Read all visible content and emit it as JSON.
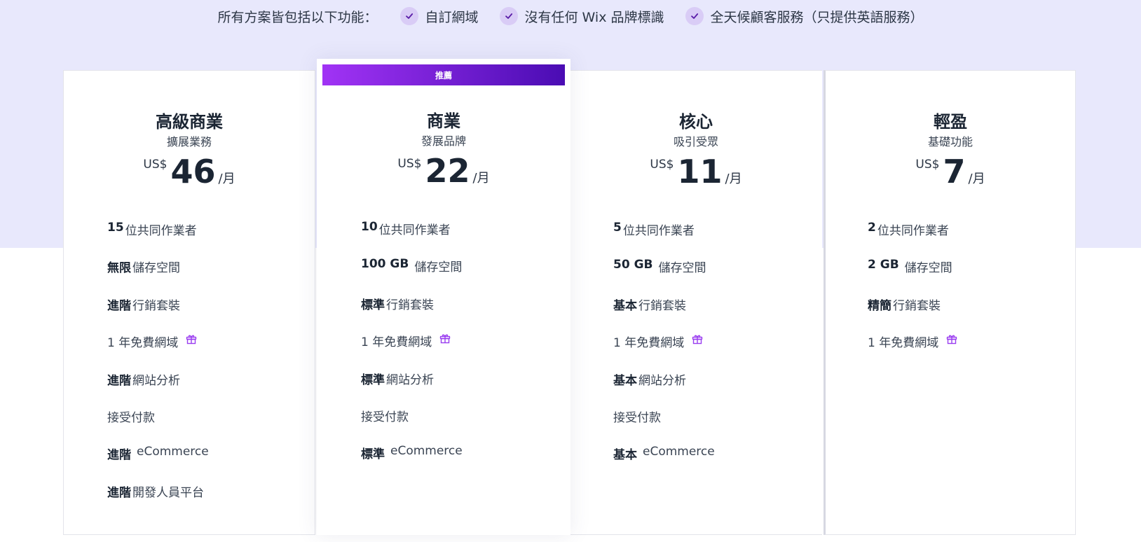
{
  "includes_bar": {
    "title": "所有方案皆包括以下功能：",
    "items": [
      {
        "label": "自訂網域"
      },
      {
        "label": "沒有任何 Wix 品牌標識"
      },
      {
        "label": "全天候顧客服務（只提供英語服務）"
      }
    ]
  },
  "colors": {
    "accent": "#7d1ce8",
    "band": "#e8e8fc",
    "badge_gradient_start": "#a133f5",
    "badge_gradient_end": "#4a0cb3",
    "icon_check": "check-icon",
    "icon_gift": "gift-icon"
  },
  "plans": [
    {
      "name": "高級商業",
      "tagline": "擴展業務",
      "currency": "US$",
      "amount": "46",
      "period": "/月",
      "features": [
        {
          "bold": "15",
          "text": "位共同作業者"
        },
        {
          "bold": "無限",
          "text": "儲存空間"
        },
        {
          "bold": "進階",
          "text": "行銷套裝"
        },
        {
          "bold": "",
          "text": "1 年免費網域",
          "gift": true
        },
        {
          "bold": "進階",
          "text": "網站分析"
        },
        {
          "bold": "",
          "text": "接受付款"
        },
        {
          "bold": "進階",
          "text": "eCommerce"
        },
        {
          "bold": "進階",
          "text": "開發人員平台"
        }
      ]
    },
    {
      "name": "商業",
      "tagline": "發展品牌",
      "badge": "推薦",
      "currency": "US$",
      "amount": "22",
      "period": "/月",
      "features": [
        {
          "bold": "10",
          "text": "位共同作業者"
        },
        {
          "bold": "100 GB",
          "text": "儲存空間"
        },
        {
          "bold": "標準",
          "text": "行銷套裝"
        },
        {
          "bold": "",
          "text": "1 年免費網域",
          "gift": true
        },
        {
          "bold": "標準",
          "text": "網站分析"
        },
        {
          "bold": "",
          "text": "接受付款"
        },
        {
          "bold": "標準",
          "text": "eCommerce"
        }
      ]
    },
    {
      "name": "核心",
      "tagline": "吸引受眾",
      "currency": "US$",
      "amount": "11",
      "period": "/月",
      "features": [
        {
          "bold": "5",
          "text": "位共同作業者"
        },
        {
          "bold": "50 GB",
          "text": "儲存空間"
        },
        {
          "bold": "基本",
          "text": "行銷套裝"
        },
        {
          "bold": "",
          "text": "1 年免費網域",
          "gift": true
        },
        {
          "bold": "基本",
          "text": "網站分析"
        },
        {
          "bold": "",
          "text": "接受付款"
        },
        {
          "bold": "基本",
          "text": "eCommerce"
        }
      ]
    },
    {
      "name": "輕盈",
      "tagline": "基礎功能",
      "currency": "US$",
      "amount": "7",
      "period": "/月",
      "features": [
        {
          "bold": "2",
          "text": "位共同作業者"
        },
        {
          "bold": "2 GB",
          "text": "儲存空間"
        },
        {
          "bold": "精簡",
          "text": "行銷套裝"
        },
        {
          "bold": "",
          "text": "1 年免費網域",
          "gift": true
        }
      ]
    }
  ]
}
